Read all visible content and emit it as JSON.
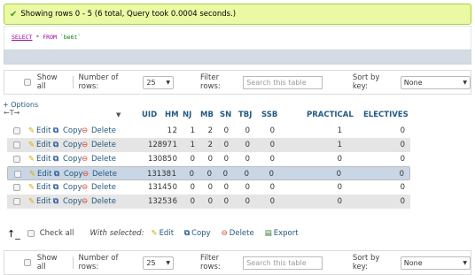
{
  "message": {
    "text": "Showing rows 0 - 5 (6 total, Query took 0.0004 seconds.)"
  },
  "sql": {
    "select": "SELECT",
    "star": "*",
    "from": "FROM",
    "table": "`be6t`"
  },
  "nav": {
    "show_all": "Show all",
    "rows_label": "Number of rows:",
    "rows_value": "25",
    "filter_label": "Filter rows:",
    "filter_placeholder": "Search this table",
    "sort_label": "Sort by key:",
    "sort_value": "None"
  },
  "options_label": "+ Options",
  "arrows_label": "←T→",
  "columns": [
    "UID",
    "HM",
    "NJ",
    "MB",
    "SN",
    "TBJ",
    "SSB",
    "PRACTICAL",
    "ELECTIVES"
  ],
  "row_actions": {
    "edit": "Edit",
    "copy": "Copy",
    "delete": "Delete"
  },
  "rows": [
    {
      "UID": "1",
      "HM": "2",
      "NJ": "1",
      "MB": "2",
      "SN": "0",
      "TBJ": "0",
      "SSB": "0",
      "PRACTICAL": "1",
      "ELECTIVES": "0"
    },
    {
      "UID": "12897",
      "HM": "1",
      "NJ": "1",
      "MB": "2",
      "SN": "0",
      "TBJ": "0",
      "SSB": "0",
      "PRACTICAL": "1",
      "ELECTIVES": "0"
    },
    {
      "UID": "13085",
      "HM": "0",
      "NJ": "0",
      "MB": "0",
      "SN": "0",
      "TBJ": "0",
      "SSB": "0",
      "PRACTICAL": "0",
      "ELECTIVES": "0"
    },
    {
      "UID": "13138",
      "HM": "1",
      "NJ": "0",
      "MB": "0",
      "SN": "0",
      "TBJ": "0",
      "SSB": "0",
      "PRACTICAL": "0",
      "ELECTIVES": "0"
    },
    {
      "UID": "13145",
      "HM": "0",
      "NJ": "0",
      "MB": "0",
      "SN": "0",
      "TBJ": "0",
      "SSB": "0",
      "PRACTICAL": "0",
      "ELECTIVES": "0"
    },
    {
      "UID": "13253",
      "HM": "6",
      "NJ": "0",
      "MB": "0",
      "SN": "0",
      "TBJ": "0",
      "SSB": "0",
      "PRACTICAL": "0",
      "ELECTIVES": "0"
    }
  ],
  "bulk": {
    "check_all": "Check all",
    "with_selected": "With selected:",
    "edit": "Edit",
    "copy": "Copy",
    "delete": "Delete",
    "export": "Export"
  }
}
